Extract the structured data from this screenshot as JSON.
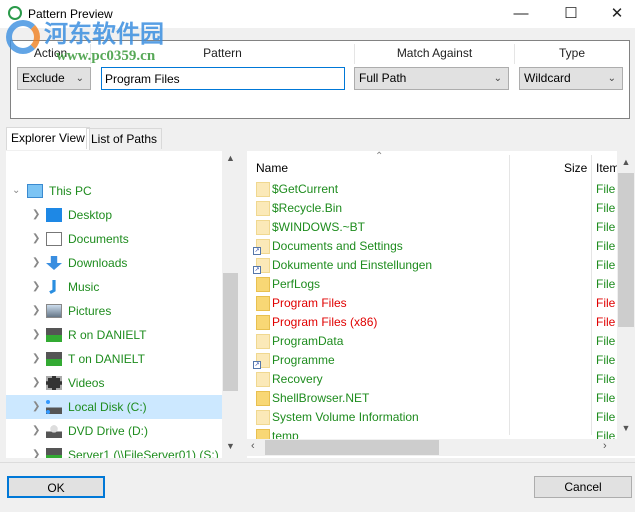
{
  "window": {
    "title": "Pattern Preview",
    "minimize": "—",
    "maximize": "☐",
    "close": "✕"
  },
  "watermark": {
    "text": "河东软件园",
    "url": "www.pc0359.cn"
  },
  "rule": {
    "headers": [
      "Action",
      "Pattern",
      "Match Against",
      "Type"
    ],
    "action": "Exclude",
    "pattern": "Program Files",
    "match_against": "Full Path",
    "type": "Wildcard"
  },
  "tabs": [
    {
      "label": "Explorer View",
      "active": true
    },
    {
      "label": "List of Paths",
      "active": false
    }
  ],
  "tree": {
    "root": "This PC",
    "items": [
      {
        "label": "Desktop",
        "icon": "desktop-icon"
      },
      {
        "label": "Documents",
        "icon": "documents-icon"
      },
      {
        "label": "Downloads",
        "icon": "downloads-icon"
      },
      {
        "label": "Music",
        "icon": "music-icon"
      },
      {
        "label": "Pictures",
        "icon": "pictures-icon"
      },
      {
        "label": "R on DANIELT",
        "icon": "network-drive-icon"
      },
      {
        "label": "T on DANIELT",
        "icon": "network-drive-icon"
      },
      {
        "label": "Videos",
        "icon": "videos-icon"
      },
      {
        "label": "Local Disk (C:)",
        "icon": "local-disk-icon",
        "selected": true
      },
      {
        "label": "DVD Drive (D:)",
        "icon": "dvd-drive-icon"
      },
      {
        "label": "Server1 (\\\\FileServer01) (S:)",
        "icon": "network-drive-icon"
      }
    ]
  },
  "list": {
    "columns": [
      "Name",
      "Size",
      "Item"
    ],
    "rows": [
      {
        "name": "$GetCurrent",
        "type": "File",
        "excluded": false,
        "style": "hidden"
      },
      {
        "name": "$Recycle.Bin",
        "type": "File",
        "excluded": false,
        "style": "hidden"
      },
      {
        "name": "$WINDOWS.~BT",
        "type": "File",
        "excluded": false,
        "style": "hidden"
      },
      {
        "name": "Documents and Settings",
        "type": "File",
        "excluded": false,
        "style": "link"
      },
      {
        "name": "Dokumente und Einstellungen",
        "type": "File",
        "excluded": false,
        "style": "link"
      },
      {
        "name": "PerfLogs",
        "type": "File",
        "excluded": false,
        "style": "folder"
      },
      {
        "name": "Program Files",
        "type": "File",
        "excluded": true,
        "style": "folder"
      },
      {
        "name": "Program Files (x86)",
        "type": "File",
        "excluded": true,
        "style": "folder"
      },
      {
        "name": "ProgramData",
        "type": "File",
        "excluded": false,
        "style": "hidden"
      },
      {
        "name": "Programme",
        "type": "File",
        "excluded": false,
        "style": "link"
      },
      {
        "name": "Recovery",
        "type": "File",
        "excluded": false,
        "style": "hidden"
      },
      {
        "name": "ShellBrowser.NET",
        "type": "File",
        "excluded": false,
        "style": "folder"
      },
      {
        "name": "System Volume Information",
        "type": "File",
        "excluded": false,
        "style": "hidden"
      },
      {
        "name": "temp",
        "type": "File",
        "excluded": false,
        "style": "folder"
      }
    ]
  },
  "buttons": {
    "ok": "OK",
    "cancel": "Cancel"
  },
  "colors": {
    "included": "#1e8c1e",
    "excluded": "#e00000",
    "selection": "#cce8ff",
    "accent": "#0078d7"
  }
}
